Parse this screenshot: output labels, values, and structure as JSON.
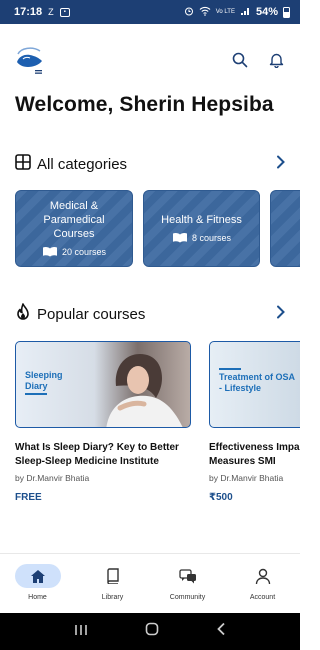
{
  "status_bar": {
    "time": "17:18",
    "left_icons": [
      "z-icon",
      "sim-icon"
    ],
    "network": "Vo LTE",
    "battery": "54%"
  },
  "header": {
    "icons": [
      "search-icon",
      "bell-icon"
    ]
  },
  "welcome": "Welcome, Sherin Hepsiba",
  "categories_section": {
    "title": "All categories",
    "items": [
      {
        "name": "Medical & Paramedical Courses",
        "count": "20 courses"
      },
      {
        "name": "Health & Fitness",
        "count": "8 courses"
      },
      {
        "name": "",
        "count": ""
      }
    ]
  },
  "popular_section": {
    "title": "Popular courses",
    "items": [
      {
        "tag": "Sleeping Diary",
        "title": "What Is Sleep Diary? Key to Better Sleep-Sleep Medicine Institute",
        "author": "by Dr.Manvir Bhatia",
        "price": "FREE"
      },
      {
        "tag": "Treatment of OSA - Lifestyle",
        "title": "Effectiveness Impa Lifestyle Measures SMI",
        "author": "by Dr.Manvir Bhatia",
        "price": "₹500"
      }
    ]
  },
  "bottom_nav": [
    {
      "label": "Home",
      "icon": "home-icon",
      "active": true
    },
    {
      "label": "Library",
      "icon": "book-icon",
      "active": false
    },
    {
      "label": "Community",
      "icon": "chat-icon",
      "active": false
    },
    {
      "label": "Account",
      "icon": "person-icon",
      "active": false
    }
  ],
  "colors": {
    "primary": "#1d3f74",
    "category_card": "#3e6aa1",
    "accent": "#1d6fb8",
    "active_nav": "#cfe1fb"
  }
}
